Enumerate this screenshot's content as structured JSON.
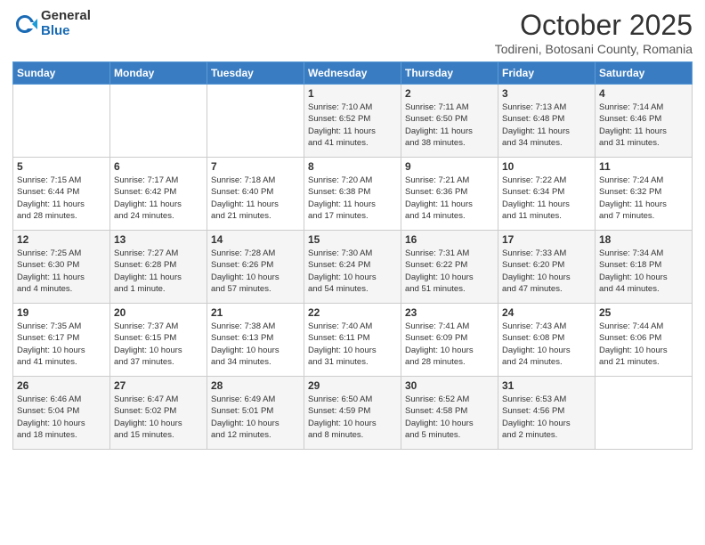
{
  "header": {
    "logo_general": "General",
    "logo_blue": "Blue",
    "month_title": "October 2025",
    "location": "Todireni, Botosani County, Romania"
  },
  "days_header": [
    "Sunday",
    "Monday",
    "Tuesday",
    "Wednesday",
    "Thursday",
    "Friday",
    "Saturday"
  ],
  "weeks": [
    [
      {
        "day": "",
        "info": ""
      },
      {
        "day": "",
        "info": ""
      },
      {
        "day": "",
        "info": ""
      },
      {
        "day": "1",
        "info": "Sunrise: 7:10 AM\nSunset: 6:52 PM\nDaylight: 11 hours\nand 41 minutes."
      },
      {
        "day": "2",
        "info": "Sunrise: 7:11 AM\nSunset: 6:50 PM\nDaylight: 11 hours\nand 38 minutes."
      },
      {
        "day": "3",
        "info": "Sunrise: 7:13 AM\nSunset: 6:48 PM\nDaylight: 11 hours\nand 34 minutes."
      },
      {
        "day": "4",
        "info": "Sunrise: 7:14 AM\nSunset: 6:46 PM\nDaylight: 11 hours\nand 31 minutes."
      }
    ],
    [
      {
        "day": "5",
        "info": "Sunrise: 7:15 AM\nSunset: 6:44 PM\nDaylight: 11 hours\nand 28 minutes."
      },
      {
        "day": "6",
        "info": "Sunrise: 7:17 AM\nSunset: 6:42 PM\nDaylight: 11 hours\nand 24 minutes."
      },
      {
        "day": "7",
        "info": "Sunrise: 7:18 AM\nSunset: 6:40 PM\nDaylight: 11 hours\nand 21 minutes."
      },
      {
        "day": "8",
        "info": "Sunrise: 7:20 AM\nSunset: 6:38 PM\nDaylight: 11 hours\nand 17 minutes."
      },
      {
        "day": "9",
        "info": "Sunrise: 7:21 AM\nSunset: 6:36 PM\nDaylight: 11 hours\nand 14 minutes."
      },
      {
        "day": "10",
        "info": "Sunrise: 7:22 AM\nSunset: 6:34 PM\nDaylight: 11 hours\nand 11 minutes."
      },
      {
        "day": "11",
        "info": "Sunrise: 7:24 AM\nSunset: 6:32 PM\nDaylight: 11 hours\nand 7 minutes."
      }
    ],
    [
      {
        "day": "12",
        "info": "Sunrise: 7:25 AM\nSunset: 6:30 PM\nDaylight: 11 hours\nand 4 minutes."
      },
      {
        "day": "13",
        "info": "Sunrise: 7:27 AM\nSunset: 6:28 PM\nDaylight: 11 hours\nand 1 minute."
      },
      {
        "day": "14",
        "info": "Sunrise: 7:28 AM\nSunset: 6:26 PM\nDaylight: 10 hours\nand 57 minutes."
      },
      {
        "day": "15",
        "info": "Sunrise: 7:30 AM\nSunset: 6:24 PM\nDaylight: 10 hours\nand 54 minutes."
      },
      {
        "day": "16",
        "info": "Sunrise: 7:31 AM\nSunset: 6:22 PM\nDaylight: 10 hours\nand 51 minutes."
      },
      {
        "day": "17",
        "info": "Sunrise: 7:33 AM\nSunset: 6:20 PM\nDaylight: 10 hours\nand 47 minutes."
      },
      {
        "day": "18",
        "info": "Sunrise: 7:34 AM\nSunset: 6:18 PM\nDaylight: 10 hours\nand 44 minutes."
      }
    ],
    [
      {
        "day": "19",
        "info": "Sunrise: 7:35 AM\nSunset: 6:17 PM\nDaylight: 10 hours\nand 41 minutes."
      },
      {
        "day": "20",
        "info": "Sunrise: 7:37 AM\nSunset: 6:15 PM\nDaylight: 10 hours\nand 37 minutes."
      },
      {
        "day": "21",
        "info": "Sunrise: 7:38 AM\nSunset: 6:13 PM\nDaylight: 10 hours\nand 34 minutes."
      },
      {
        "day": "22",
        "info": "Sunrise: 7:40 AM\nSunset: 6:11 PM\nDaylight: 10 hours\nand 31 minutes."
      },
      {
        "day": "23",
        "info": "Sunrise: 7:41 AM\nSunset: 6:09 PM\nDaylight: 10 hours\nand 28 minutes."
      },
      {
        "day": "24",
        "info": "Sunrise: 7:43 AM\nSunset: 6:08 PM\nDaylight: 10 hours\nand 24 minutes."
      },
      {
        "day": "25",
        "info": "Sunrise: 7:44 AM\nSunset: 6:06 PM\nDaylight: 10 hours\nand 21 minutes."
      }
    ],
    [
      {
        "day": "26",
        "info": "Sunrise: 6:46 AM\nSunset: 5:04 PM\nDaylight: 10 hours\nand 18 minutes."
      },
      {
        "day": "27",
        "info": "Sunrise: 6:47 AM\nSunset: 5:02 PM\nDaylight: 10 hours\nand 15 minutes."
      },
      {
        "day": "28",
        "info": "Sunrise: 6:49 AM\nSunset: 5:01 PM\nDaylight: 10 hours\nand 12 minutes."
      },
      {
        "day": "29",
        "info": "Sunrise: 6:50 AM\nSunset: 4:59 PM\nDaylight: 10 hours\nand 8 minutes."
      },
      {
        "day": "30",
        "info": "Sunrise: 6:52 AM\nSunset: 4:58 PM\nDaylight: 10 hours\nand 5 minutes."
      },
      {
        "day": "31",
        "info": "Sunrise: 6:53 AM\nSunset: 4:56 PM\nDaylight: 10 hours\nand 2 minutes."
      },
      {
        "day": "",
        "info": ""
      }
    ]
  ]
}
